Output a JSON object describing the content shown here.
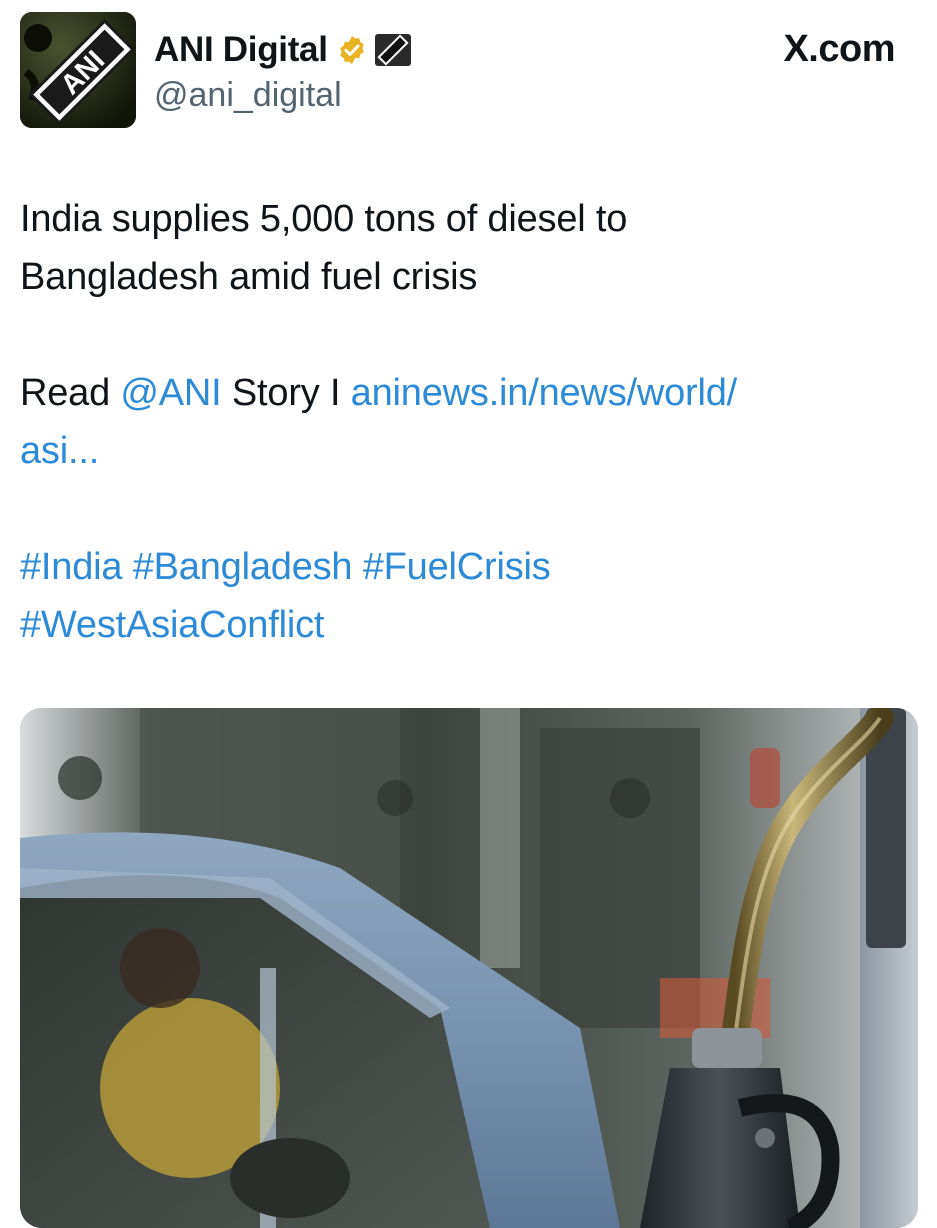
{
  "header": {
    "display_name": "ANI Digital",
    "handle": "@ani_digital",
    "site": "X.com",
    "avatar_text": "ANI",
    "verified_color": "#e8b322",
    "icons": [
      "verified-badge-icon",
      "ani-logo-icon"
    ]
  },
  "tweet": {
    "headline_line1": "India supplies 5,000 tons of diesel to",
    "headline_line2": "Bangladesh amid fuel crisis",
    "read_prefix": "Read",
    "mention": "@ANI",
    "story_word": "Story I",
    "link_line1": "aninews.in/news/world/",
    "link_line2": "asi...",
    "hashtags": [
      "#India",
      "#Bangladesh",
      "#FuelCrisis",
      "#WestAsiaConflict"
    ]
  },
  "colors": {
    "link": "#2d8ad6",
    "text": "#0f1419",
    "muted": "#536471"
  },
  "media": {
    "type": "photo",
    "subject": "fuel-nozzle-and-car"
  }
}
